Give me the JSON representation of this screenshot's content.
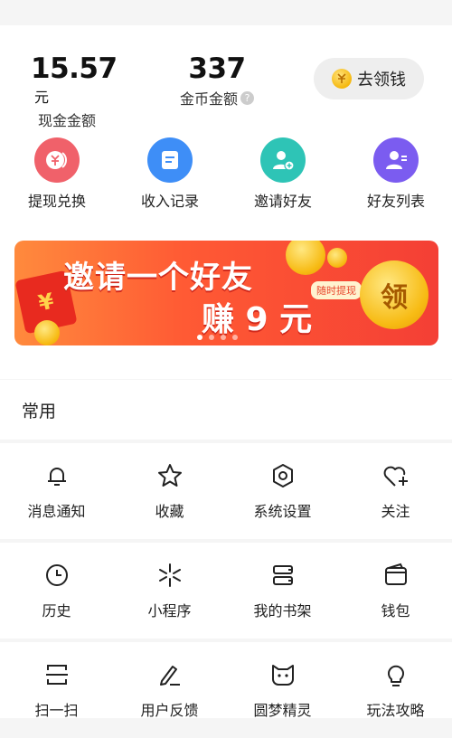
{
  "wallet": {
    "cash_value": "15.57",
    "cash_unit": "元",
    "cash_label": "现金金额",
    "coin_value": "337",
    "coin_label": "金币金额",
    "help_symbol": "?",
    "earn_button": "去领钱"
  },
  "quick_actions": [
    {
      "label": "提现兑换",
      "icon": "exchange-icon",
      "color": "#f0616a"
    },
    {
      "label": "收入记录",
      "icon": "record-icon",
      "color": "#3e8ef7"
    },
    {
      "label": "邀请好友",
      "icon": "invite-user-icon",
      "color": "#2ec4b6"
    },
    {
      "label": "好友列表",
      "icon": "friend-list-icon",
      "color": "#7b5cf0"
    }
  ],
  "banner": {
    "headline": "邀请一个好友",
    "reward": "赚 9 元",
    "tag": "随时提现",
    "coin_text": "领",
    "envelope_text": "¥",
    "dots": 4,
    "active_dot": 0
  },
  "common": {
    "title": "常用",
    "items": [
      {
        "label": "消息通知",
        "icon": "bell-icon"
      },
      {
        "label": "收藏",
        "icon": "star-icon"
      },
      {
        "label": "系统设置",
        "icon": "gear-icon"
      },
      {
        "label": "关注",
        "icon": "heart-plus-icon"
      },
      {
        "label": "历史",
        "icon": "clock-icon"
      },
      {
        "label": "小程序",
        "icon": "mini-program-icon"
      },
      {
        "label": "我的书架",
        "icon": "bookshelf-icon"
      },
      {
        "label": "钱包",
        "icon": "wallet-icon"
      },
      {
        "label": "扫一扫",
        "icon": "scan-icon"
      },
      {
        "label": "用户反馈",
        "icon": "feedback-icon"
      },
      {
        "label": "圆梦精灵",
        "icon": "cat-icon"
      },
      {
        "label": "玩法攻略",
        "icon": "lightbulb-icon"
      }
    ]
  }
}
